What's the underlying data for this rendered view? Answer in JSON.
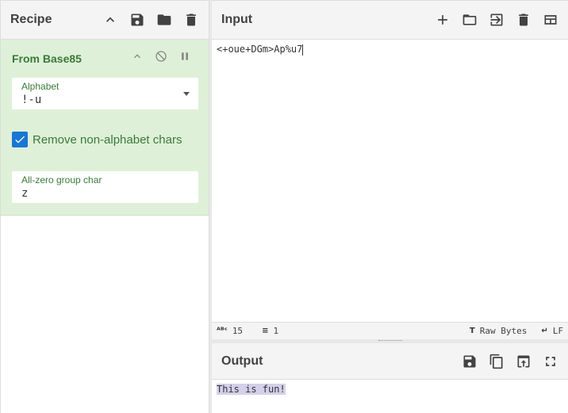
{
  "recipe": {
    "title": "Recipe",
    "operation": {
      "title": "From Base85",
      "alphabet_label": "Alphabet",
      "alphabet_value": "!-u",
      "remove_label": "Remove non-alphabet chars",
      "zero_label": "All-zero group char",
      "zero_value": "z"
    }
  },
  "input": {
    "title": "Input",
    "text": "<+oue+DGm>Ap%u7",
    "status": {
      "length": "15",
      "lines": "1",
      "encoding": "Raw Bytes",
      "eol": "LF"
    }
  },
  "output": {
    "title": "Output",
    "text": "This is fun!"
  }
}
